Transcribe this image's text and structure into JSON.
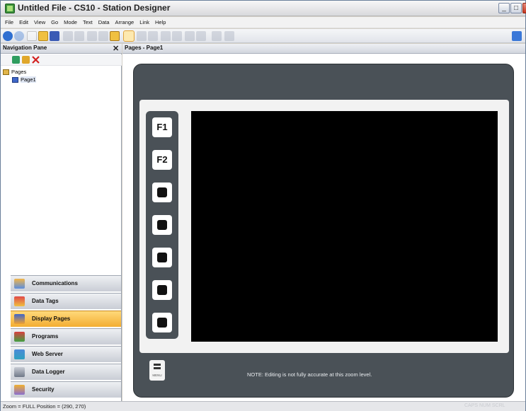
{
  "window": {
    "title": "Untitled File - CS10 - Station Designer"
  },
  "menu": [
    "File",
    "Edit",
    "View",
    "Go",
    "Mode",
    "Text",
    "Data",
    "Arrange",
    "Link",
    "Help"
  ],
  "nav_pane": {
    "title": "Navigation Pane",
    "close_glyph": "✕",
    "tree": {
      "root": "Pages",
      "child": "Page1"
    },
    "buttons": [
      {
        "label": "Communications",
        "icon": "communications-icon"
      },
      {
        "label": "Data Tags",
        "icon": "data-tags-icon"
      },
      {
        "label": "Display Pages",
        "icon": "display-pages-icon",
        "active": true
      },
      {
        "label": "Programs",
        "icon": "programs-icon"
      },
      {
        "label": "Web Server",
        "icon": "web-server-icon"
      },
      {
        "label": "Data Logger",
        "icon": "data-logger-icon"
      },
      {
        "label": "Security",
        "icon": "security-icon"
      }
    ]
  },
  "editor": {
    "tab_label": "Pages - Page1",
    "keys": [
      "F1",
      "F2",
      "",
      "",
      "",
      "",
      ""
    ],
    "menu_key_text": "MENU",
    "note": "NOTE: Editing is not fully accurate at this zoom level."
  },
  "status": {
    "text": "Zoom = FULL  Position = (290, 270)",
    "right": "CAPS  NUM  SCRL"
  },
  "colors": {
    "active_nav": "#f3ad32",
    "device_body": "#4a5157",
    "screen": "#000000"
  }
}
